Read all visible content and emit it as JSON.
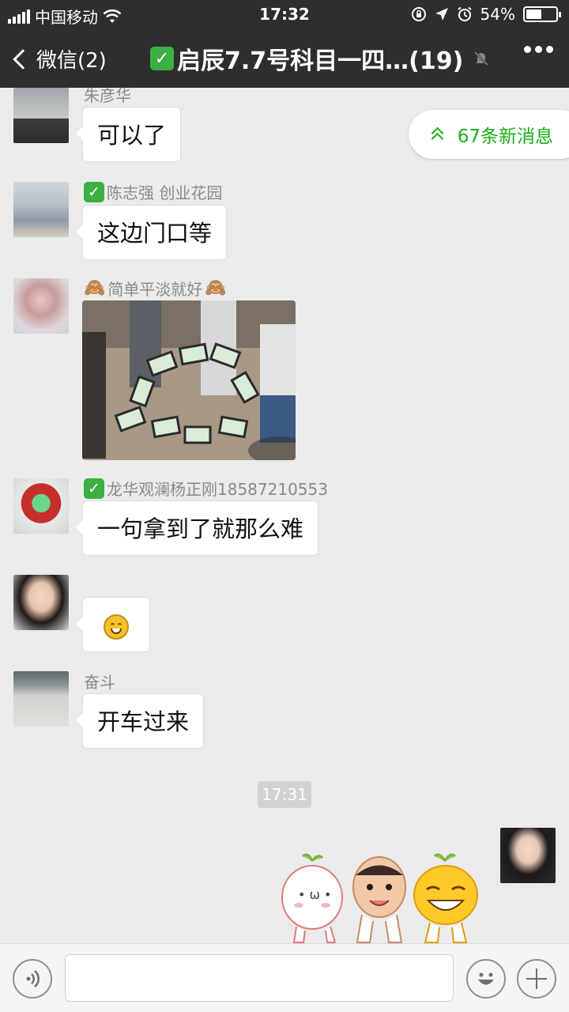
{
  "status_bar": {
    "carrier": "中国移动",
    "time": "17:32",
    "battery": "54%",
    "battery_level": 0.54
  },
  "nav": {
    "back_label": "微信(2)",
    "title": "启辰7.7号科目一四…(19)"
  },
  "new_messages": {
    "label": "67条新消息"
  },
  "messages": [
    {
      "sender": "朱彦华",
      "text": "可以了"
    },
    {
      "sender": "陈志强  创业花园",
      "text": "这边门口等"
    },
    {
      "sender": "简单平淡就好",
      "sender_emoji": "🙈"
    },
    {
      "sender": "龙华观澜杨正刚18587210553",
      "text": "一句拿到了就那么难"
    },
    {
      "sender": ""
    },
    {
      "sender": "奋斗",
      "text": "开车过来"
    }
  ],
  "time_divider": "17:31",
  "input": {
    "placeholder": ""
  },
  "colors": {
    "header": "#2e2e2e",
    "background": "#ebebeb",
    "accent": "#1aad19",
    "check": "#3cb043"
  }
}
